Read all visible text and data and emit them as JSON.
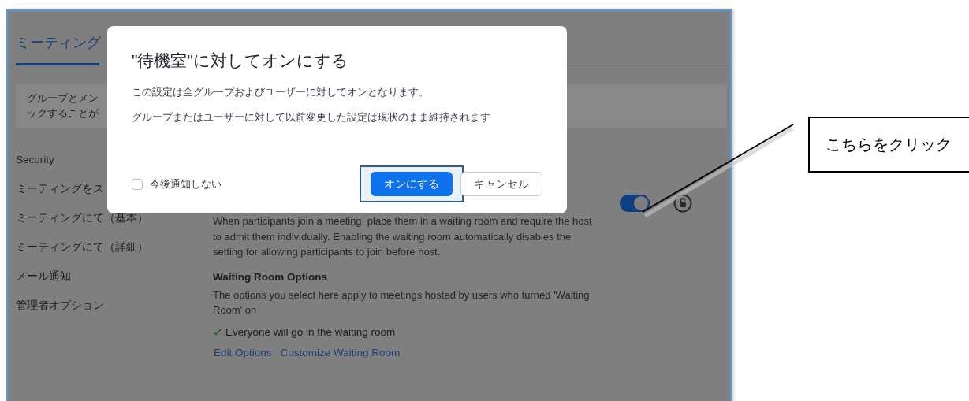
{
  "page": {
    "tab": {
      "label": "ミーティング",
      "selected": true
    },
    "notice": [
      "グループとメン",
      "ックすることが"
    ],
    "sidebar": {
      "items": [
        "Security",
        "ミーティングをス",
        "ミーティングにて（基本）",
        "ミーティングにて（詳細）",
        "メール通知",
        "管理者オプション"
      ]
    },
    "setting": {
      "on": true,
      "description": "When participants join a meeting, place them in a waiting room and require the host to admit them individually. Enabling the waiting room automatically disables the setting for allowing participants to join before host.",
      "options_title": "Waiting Room Options",
      "options_description": "The options you select here apply to meetings hosted by users who turned 'Waiting Room' on",
      "options": [
        {
          "label": "Everyone will go in the waiting room",
          "checked": true
        }
      ],
      "links": [
        "Edit Options",
        "Customize Waiting Room"
      ]
    }
  },
  "dialog": {
    "title": "\"待機室\"に対してオンにする",
    "lines": [
      "この設定は全グループおよびユーザーに対してオンとなります。",
      "グループまたはユーザーに対して以前変更した設定は現状のまま維持されます"
    ],
    "checkbox": {
      "label": "今後通知しない",
      "checked": false
    },
    "buttons": [
      {
        "label": "オンにする",
        "kind": "primary",
        "highlighted": true
      },
      {
        "label": "キャンセル",
        "kind": "secondary",
        "highlighted": false
      }
    ]
  },
  "callout": {
    "text": "こちらをクリック"
  }
}
